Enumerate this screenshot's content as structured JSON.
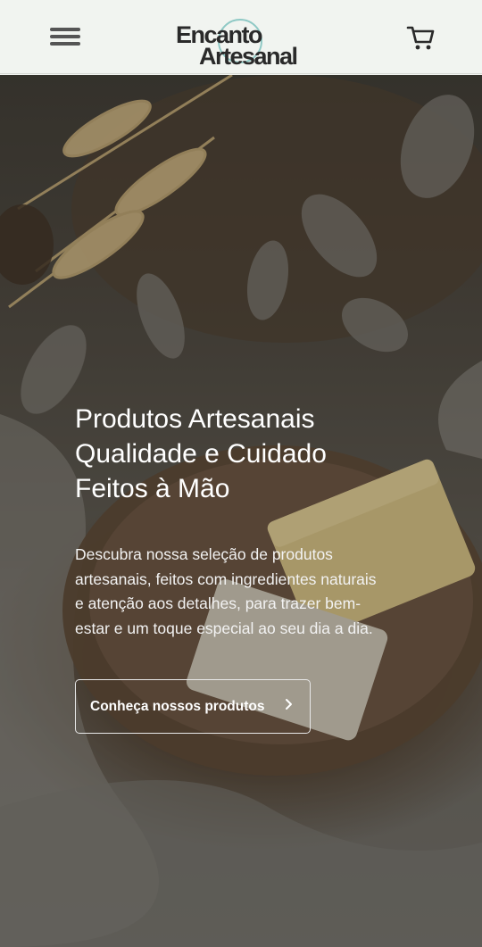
{
  "header": {
    "logo_line1": "Encanto",
    "logo_line2": "Artesanal",
    "menu_icon": "hamburger-menu-icon",
    "cart_icon": "shopping-cart-icon"
  },
  "hero": {
    "title_lines": [
      "Produtos Artesanais",
      "Qualidade e Cuidado",
      "Feitos à Mão"
    ],
    "description_lines": [
      "Descubra nossa seleção de produtos",
      "artesanais, feitos com ingredientes naturais",
      "e atenção aos detalhes, para trazer bem-",
      "estar e um toque especial ao seu dia a dia."
    ],
    "cta_label": "Conheça nossos produtos",
    "cta_icon": "chevron-right-icon"
  },
  "colors": {
    "header_bg": "#f1f4f0",
    "logo_accent": "#8fc9c5",
    "text_on_hero": "#ffffff"
  }
}
